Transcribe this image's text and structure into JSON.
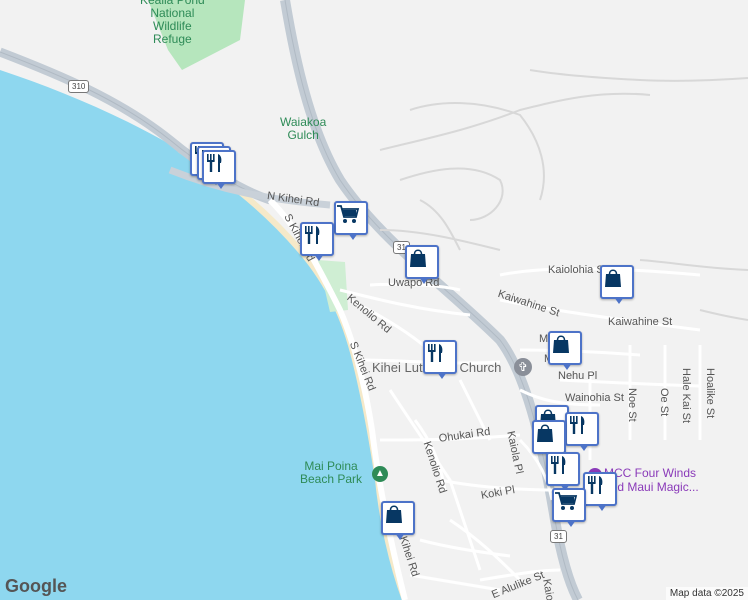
{
  "map": {
    "colors": {
      "water": "#8ed7ef",
      "land": "#f2f2f2",
      "park": "#b6e6bd",
      "highway": "#c2cbd4",
      "road": "#ffffff",
      "pin_border": "#4d73c8",
      "pin_icon": "#073763"
    },
    "parks": {
      "kealia": "Kealia Pond\nNational\nWildlife\nRefuge",
      "mai_poina": "Mai Poina\nBeach Park"
    },
    "areas": {
      "waiakoa": "Waiakoa\nGulch"
    },
    "shields": {
      "hwy310": "310",
      "hwy31_north": "31",
      "hwy31_south": "31"
    },
    "streets": {
      "n_kihei": "N Kihei Rd",
      "s_kihei_1": "S Kihei Rd",
      "s_kihei_2": "S Kihei Rd",
      "s_kihei_3": "S Kihei Rd",
      "kenolio_1": "Kenolio Rd",
      "kenolio_2": "Kenolio Rd",
      "uwapo": "Uwapo Rd",
      "kaiolohia": "Kaiolohia St",
      "kaiwahine_1": "Kaiwahine St",
      "kaiwahine_2": "Kaiwahine St",
      "nehu": "Nehu Pl",
      "wainohia": "Wainohia St",
      "ohukai": "Ohukai Rd",
      "kaiola": "Kaiola Pl",
      "koki": "Koki Pl",
      "e_alulike": "E Alulike St",
      "noe": "Noe St",
      "oe": "Oe St",
      "hale_kai": "Hale Kai St",
      "hoalike": "Hoalike St",
      "kaio": "Kaio",
      "m_1": "M",
      "m_2": "M"
    },
    "pois": {
      "church": "Kihei Lutheran Church",
      "mcc": "MCC Four Winds\nand Maui Magic..."
    },
    "markers": [
      {
        "type": "restaurant",
        "icon": "fork-knife-icon"
      },
      {
        "type": "restaurant",
        "icon": "fork-knife-icon"
      },
      {
        "type": "restaurant",
        "icon": "fork-knife-icon"
      },
      {
        "type": "grocery",
        "icon": "shopping-cart-icon"
      },
      {
        "type": "restaurant",
        "icon": "fork-knife-icon"
      },
      {
        "type": "shopping",
        "icon": "shopping-bag-icon"
      },
      {
        "type": "shopping",
        "icon": "shopping-bag-icon"
      },
      {
        "type": "restaurant",
        "icon": "fork-knife-icon"
      },
      {
        "type": "shopping",
        "icon": "shopping-bag-icon"
      },
      {
        "type": "shopping",
        "icon": "shopping-bag-icon"
      },
      {
        "type": "restaurant",
        "icon": "fork-knife-icon"
      },
      {
        "type": "shopping",
        "icon": "shopping-bag-icon"
      },
      {
        "type": "restaurant",
        "icon": "fork-knife-icon"
      },
      {
        "type": "restaurant",
        "icon": "fork-knife-icon"
      },
      {
        "type": "grocery",
        "icon": "shopping-cart-icon"
      },
      {
        "type": "shopping",
        "icon": "shopping-bag-icon"
      }
    ],
    "logo": "Google",
    "attribution": "Map data ©2025"
  }
}
